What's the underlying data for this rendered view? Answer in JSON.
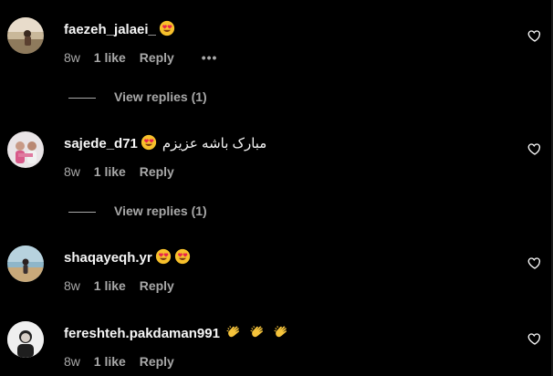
{
  "colors": {
    "background": "#000000",
    "primary_text": "#f5f5f5",
    "secondary_text": "#a8a8a8"
  },
  "comments": [
    {
      "username": "faezeh_jalaei_",
      "text": "",
      "emojis": [
        "heart-eyes-emoji"
      ],
      "time": "8w",
      "likes": "1 like",
      "reply": "Reply",
      "more": "•••",
      "view_replies": "View replies (1)"
    },
    {
      "username": "sajede_d71",
      "text": "مبارک باشه عزیزم",
      "emojis": [
        "heart-eyes-emoji"
      ],
      "time": "8w",
      "likes": "1 like",
      "reply": "Reply",
      "view_replies": "View replies (1)"
    },
    {
      "username": "shaqayeqh.yr",
      "text": "",
      "emojis": [
        "heart-eyes-emoji",
        "heart-eyes-emoji"
      ],
      "time": "8w",
      "likes": "1 like",
      "reply": "Reply"
    },
    {
      "username": "fereshteh.pakdaman991",
      "text": "",
      "emojis": [
        "clapping-hands-emoji",
        "clapping-hands-emoji",
        "clapping-hands-emoji"
      ],
      "time": "8w",
      "likes": "1 like",
      "reply": "Reply"
    }
  ]
}
